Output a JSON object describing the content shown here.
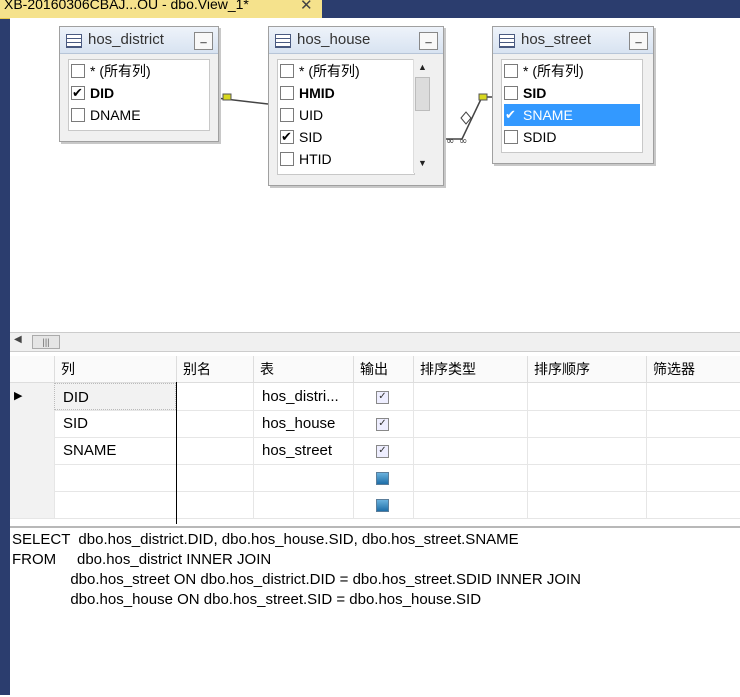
{
  "tab": {
    "title": "XB-20160306CBAJ...OU - dbo.View_1*",
    "close": "✕"
  },
  "diagram": {
    "tables": [
      {
        "name": "hos_district",
        "minimize": "_",
        "columns": [
          {
            "label": "* (所有列)",
            "checked": false,
            "bold": false
          },
          {
            "label": "DID",
            "checked": true,
            "bold": true
          },
          {
            "label": "DNAME",
            "checked": false,
            "bold": false
          }
        ]
      },
      {
        "name": "hos_house",
        "minimize": "_",
        "columns": [
          {
            "label": "* (所有列)",
            "checked": false,
            "bold": false
          },
          {
            "label": "HMID",
            "checked": false,
            "bold": true
          },
          {
            "label": "UID",
            "checked": false,
            "bold": false
          },
          {
            "label": "SID",
            "checked": true,
            "bold": false
          },
          {
            "label": "HTID",
            "checked": false,
            "bold": false
          }
        ]
      },
      {
        "name": "hos_street",
        "minimize": "_",
        "columns": [
          {
            "label": "* (所有列)",
            "checked": false,
            "bold": false
          },
          {
            "label": "SID",
            "checked": false,
            "bold": true
          },
          {
            "label": "SNAME",
            "checked": true,
            "bold": false,
            "selected": true
          },
          {
            "label": "SDID",
            "checked": false,
            "bold": false
          }
        ]
      }
    ]
  },
  "grid": {
    "headers": [
      "列",
      "别名",
      "表",
      "输出",
      "排序类型",
      "排序顺序",
      "筛选器"
    ],
    "rows": [
      {
        "column": "DID",
        "alias": "",
        "table": "hos_distri...",
        "output": true
      },
      {
        "column": "SID",
        "alias": "",
        "table": "hos_house",
        "output": true
      },
      {
        "column": "SNAME",
        "alias": "",
        "table": "hos_street",
        "output": true
      },
      {
        "column": "",
        "alias": "",
        "table": "",
        "output": null
      },
      {
        "column": "",
        "alias": "",
        "table": "",
        "output": null
      }
    ],
    "current_row_marker": "▶"
  },
  "sql": {
    "lines": [
      "SELECT  dbo.hos_district.DID, dbo.hos_house.SID, dbo.hos_street.SNAME",
      "FROM     dbo.hos_district INNER JOIN",
      "              dbo.hos_street ON dbo.hos_district.DID = dbo.hos_street.SDID INNER JOIN",
      "              dbo.hos_house ON dbo.hos_street.SID = dbo.hos_house.SID"
    ]
  },
  "colors": {
    "selected": "#3399ff",
    "tab_active": "#f5e28c",
    "frame": "#2b3d6e"
  }
}
